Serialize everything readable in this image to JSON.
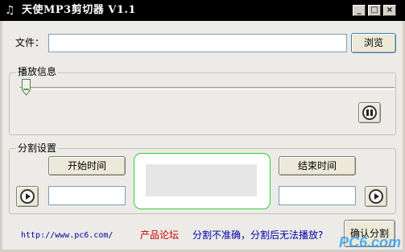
{
  "window": {
    "title": "天使MP3剪切器 V1.1",
    "controls": {
      "minimize": "_",
      "maximize": "□",
      "close": "×"
    }
  },
  "file": {
    "label": "文件：",
    "value": "",
    "browse_label": "浏览"
  },
  "playback": {
    "group_label": "播放信息",
    "position": 0
  },
  "split": {
    "group_label": "分割设置",
    "start_button": "开始时间",
    "end_button": "结束时间",
    "start_value": "",
    "end_value": ""
  },
  "footer": {
    "url": "http://www.pc6.com/",
    "forum": "产品论坛",
    "help": "分割不准确，分割后无法播放?",
    "confirm": "确认分割",
    "watermark": "PC6.com"
  },
  "icons": {
    "app": "♫",
    "play": "play-icon",
    "pause": "pause-icon"
  },
  "colors": {
    "forum": "#cc0000",
    "help": "#0000aa",
    "highlight_frame": "#33cc33",
    "watermark": "#2a9df4"
  }
}
